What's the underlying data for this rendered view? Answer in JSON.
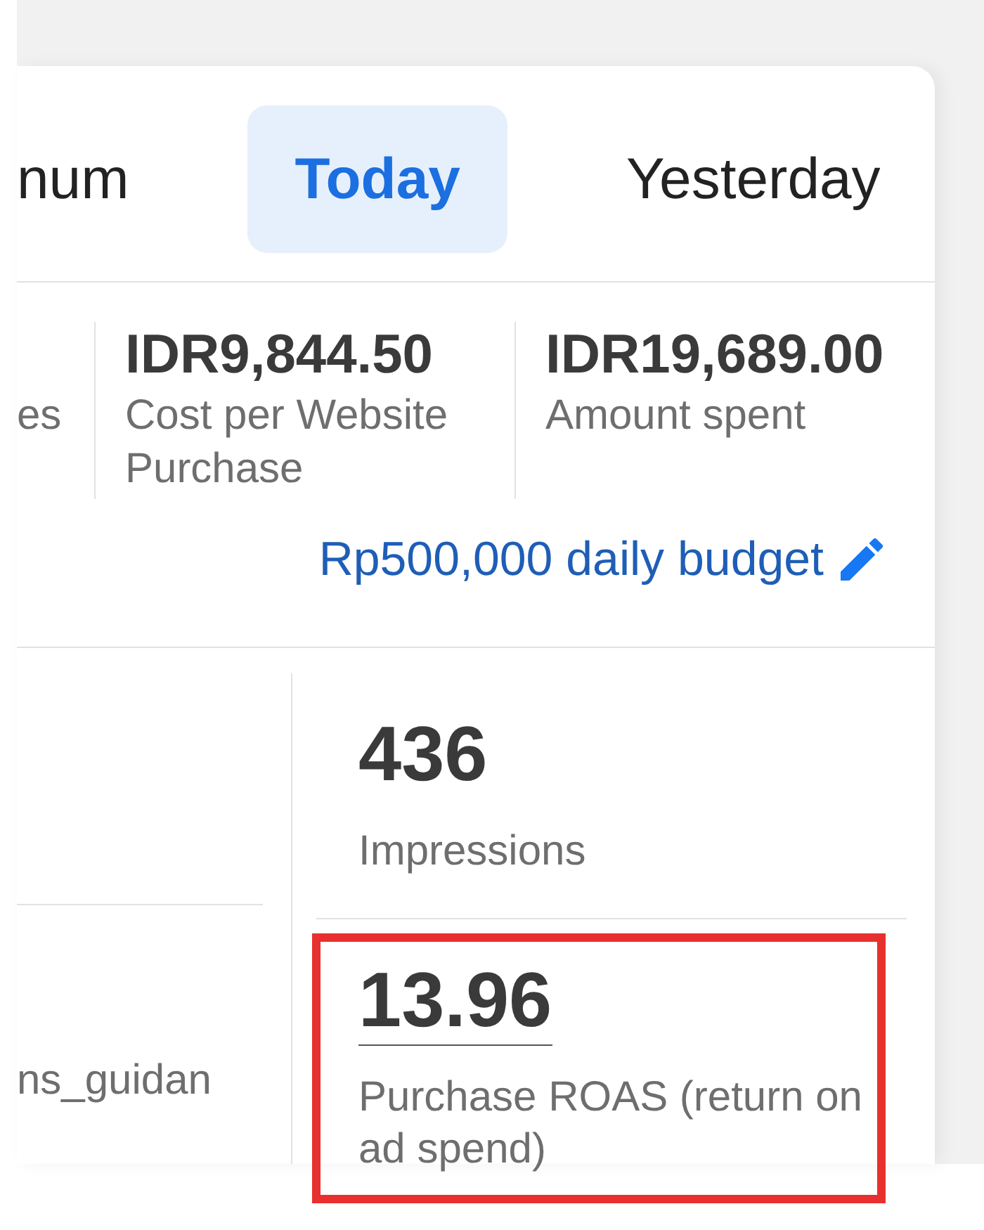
{
  "tabs": [
    {
      "label": "num",
      "selected": false
    },
    {
      "label": "Today",
      "selected": true
    },
    {
      "label": "Yesterday",
      "selected": false
    }
  ],
  "summary": [
    {
      "label": "es"
    },
    {
      "value": "IDR9,844.50",
      "label": "Cost per Website Purchase"
    },
    {
      "value": "IDR19,689.00",
      "label": "Amount spent"
    }
  ],
  "budget": {
    "label": "Rp500,000 daily budget"
  },
  "side_metric": {
    "label": "ns_guidan"
  },
  "metrics": [
    {
      "value": "436",
      "label": "Impressions",
      "underlined": false,
      "highlighted": false
    },
    {
      "value": "13.96",
      "label": "Purchase ROAS (return on ad spend)",
      "underlined": true,
      "highlighted": true
    }
  ]
}
